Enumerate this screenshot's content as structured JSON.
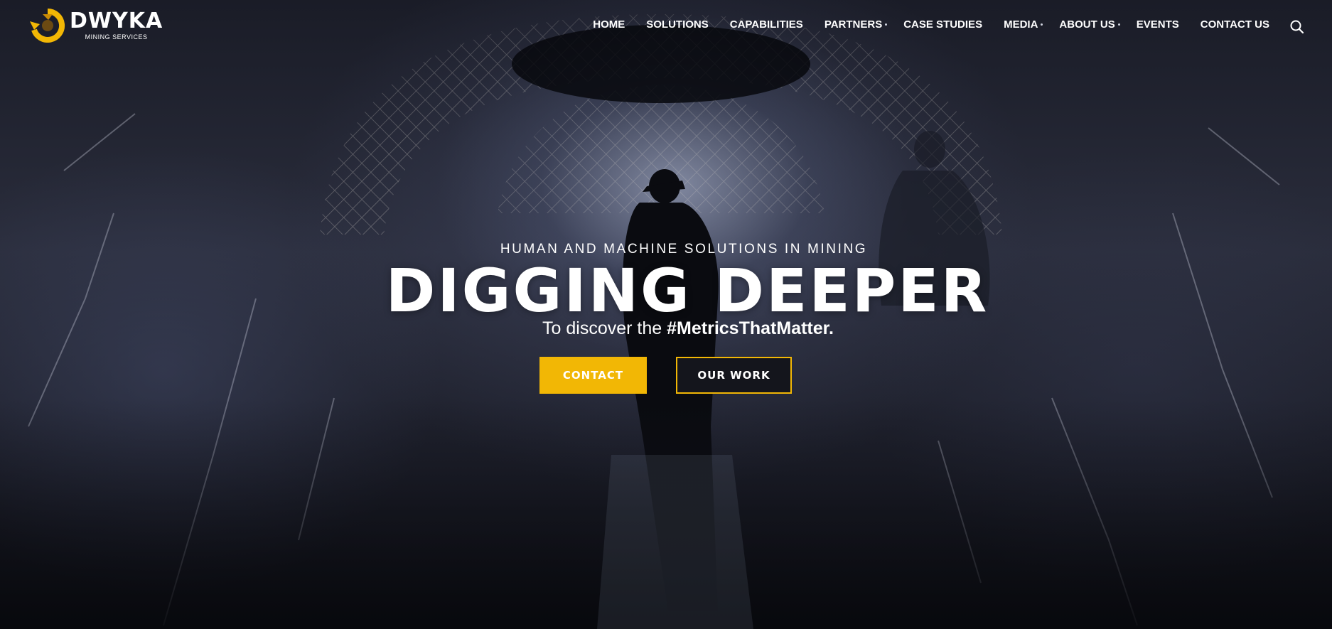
{
  "brand": {
    "name": "DWYKA",
    "subtitle": "MINING SERVICES",
    "logo_icon": "dwyka-logo-mark",
    "accent_color": "#f2b705"
  },
  "nav": {
    "items": [
      {
        "label": "HOME"
      },
      {
        "label": "SOLUTIONS"
      },
      {
        "label": "CAPABILITIES"
      },
      {
        "label": "PARTNERS"
      },
      {
        "label": "CASE STUDIES"
      },
      {
        "label": "MEDIA"
      },
      {
        "label": "ABOUT US"
      },
      {
        "label": "EVENTS"
      },
      {
        "label": "CONTACT US"
      }
    ],
    "search_icon": "search-icon"
  },
  "hero": {
    "eyebrow": "HUMAN AND MACHINE SOLUTIONS IN MINING",
    "headline": "DIGGING DEEPER",
    "tagline_prefix": "To discover the ",
    "tagline_hashtag": "#MetricsThatMatter.",
    "primary_button": "CONTACT",
    "secondary_button": "OUR WORK"
  }
}
